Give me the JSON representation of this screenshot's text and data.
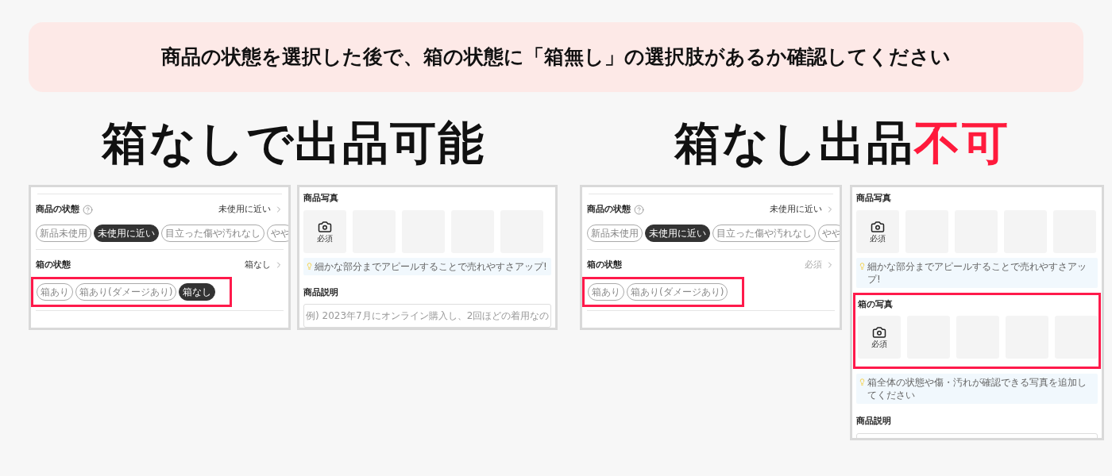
{
  "banner": "商品の状態を選択した後で、箱の状態に「箱無し」の選択肢があるか確認してください",
  "columns": [
    {
      "title": [
        {
          "text": "箱なしで出品可能",
          "color": "#111111"
        }
      ],
      "screens": [
        {
          "kind": "condition",
          "sections": [
            {
              "label": "商品の状態",
              "help": true,
              "value": "未使用に近い",
              "muted": false,
              "highlighted": false,
              "chips": [
                {
                  "label": "新品未使用",
                  "selected": false
                },
                {
                  "label": "未使用に近い",
                  "selected": true
                },
                {
                  "label": "目立った傷や汚れなし",
                  "selected": false
                },
                {
                  "label": "やや",
                  "selected": false
                }
              ]
            },
            {
              "label": "箱の状態",
              "help": false,
              "value": "箱なし",
              "muted": false,
              "highlighted": true,
              "chips": [
                {
                  "label": "箱あり",
                  "selected": false
                },
                {
                  "label": "箱あり(ダメージあり)",
                  "selected": false
                },
                {
                  "label": "箱なし",
                  "selected": true
                }
              ]
            }
          ]
        },
        {
          "kind": "photos",
          "sections": [
            {
              "kind": "photo_group",
              "title": "商品写真",
              "highlighted": false,
              "slots": [
                {
                  "kind": "camera",
                  "label": "必須"
                },
                {
                  "kind": "empty"
                },
                {
                  "kind": "empty"
                },
                {
                  "kind": "empty"
                },
                {
                  "kind": "empty"
                }
              ]
            },
            {
              "kind": "tip",
              "text": "細かな部分までアピールすることで売れやすさアップ!"
            },
            {
              "kind": "description",
              "title": "商品説明",
              "placeholder": "例) 2023年7月にオンライン購入し、2回ほどの着用なの"
            }
          ]
        }
      ]
    },
    {
      "title": [
        {
          "text": "箱なし出品",
          "color": "#111111"
        },
        {
          "text": "不可",
          "color": "#ff1a3c"
        }
      ],
      "screens": [
        {
          "kind": "condition",
          "sections": [
            {
              "label": "商品の状態",
              "help": true,
              "value": "未使用に近い",
              "muted": false,
              "highlighted": false,
              "chips": [
                {
                  "label": "新品未使用",
                  "selected": false
                },
                {
                  "label": "未使用に近い",
                  "selected": true
                },
                {
                  "label": "目立った傷や汚れなし",
                  "selected": false
                },
                {
                  "label": "やや",
                  "selected": false
                }
              ]
            },
            {
              "label": "箱の状態",
              "help": false,
              "value": "必須",
              "muted": true,
              "highlighted": true,
              "chips": [
                {
                  "label": "箱あり",
                  "selected": false
                },
                {
                  "label": "箱あり(ダメージあり)",
                  "selected": false
                }
              ]
            }
          ]
        },
        {
          "kind": "photos",
          "sections": [
            {
              "kind": "photo_group",
              "title": "商品写真",
              "highlighted": false,
              "slots": [
                {
                  "kind": "camera",
                  "label": "必須"
                },
                {
                  "kind": "empty"
                },
                {
                  "kind": "empty"
                },
                {
                  "kind": "empty"
                },
                {
                  "kind": "empty"
                }
              ]
            },
            {
              "kind": "tip",
              "text": "細かな部分までアピールすることで売れやすさアップ!"
            },
            {
              "kind": "photo_group",
              "title": "箱の写真",
              "highlighted": true,
              "slots": [
                {
                  "kind": "camera",
                  "label": "必須"
                },
                {
                  "kind": "empty"
                },
                {
                  "kind": "empty"
                },
                {
                  "kind": "empty"
                },
                {
                  "kind": "empty"
                }
              ]
            },
            {
              "kind": "tip",
              "text": "箱全体の状態や傷・汚れが確認できる写真を追加してください"
            },
            {
              "kind": "description",
              "title": "商品説明"
            }
          ]
        }
      ]
    }
  ]
}
